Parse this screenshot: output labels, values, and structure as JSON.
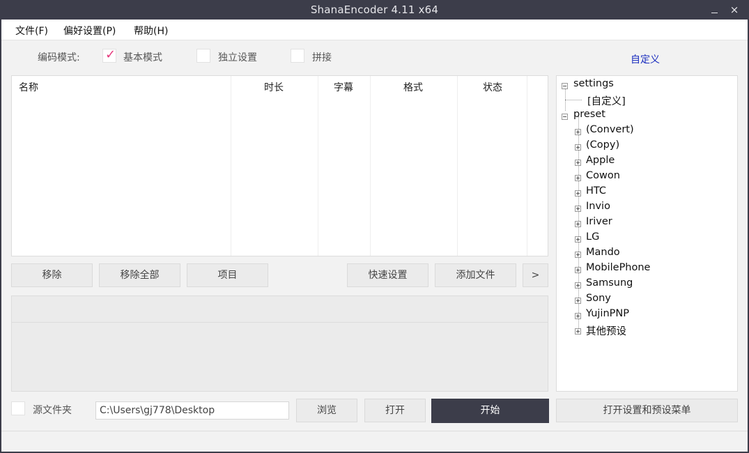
{
  "window": {
    "title": "ShanaEncoder 4.11 x64",
    "minimize_glyph": "_",
    "close_glyph": "×"
  },
  "menu": {
    "file": "文件(F)",
    "preferences": "偏好设置(P)",
    "help": "帮助(H)"
  },
  "mode": {
    "label": "编码模式:",
    "basic": "基本模式",
    "basic_checked": true,
    "independent": "独立设置",
    "join": "拼接",
    "custom_link": "自定义"
  },
  "file_list": {
    "columns": [
      "名称",
      "时长",
      "字幕",
      "格式",
      "状态"
    ]
  },
  "buttons": {
    "remove": "移除",
    "remove_all": "移除全部",
    "items": "项目",
    "quick_settings": "快速设置",
    "add_file": "添加文件",
    "more": ">",
    "browse": "浏览",
    "open": "打开",
    "start": "开始",
    "open_settings_menu": "打开设置和预设菜单"
  },
  "source_folder": {
    "label": "源文件夹",
    "path": "C:\\Users\\gj778\\Desktop"
  },
  "tree": {
    "settings": "settings",
    "custom": "[自定义]",
    "preset": "preset",
    "presets": [
      "(Convert)",
      "(Copy)",
      "Apple",
      "Cowon",
      "HTC",
      "Invio",
      "Iriver",
      "LG",
      "Mando",
      "MobilePhone",
      "Samsung",
      "Sony",
      "YujinPNP",
      "其他预设"
    ]
  },
  "colors": {
    "titlebar": "#3c3d4a",
    "check_accent": "#e53a7d",
    "link": "#1a2dbf",
    "start_button": "#3c3d4a"
  }
}
